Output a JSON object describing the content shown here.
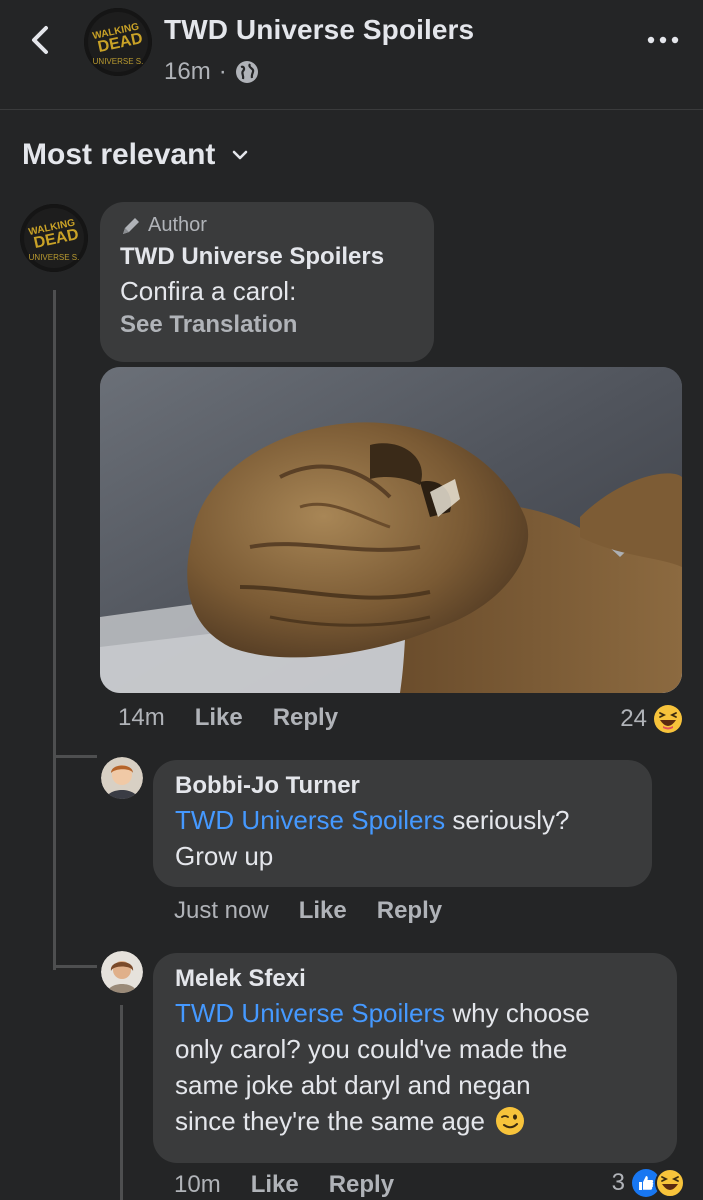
{
  "header": {
    "title": "TWD Universe Spoilers",
    "time": "16m",
    "separator": "·",
    "logo_text": {
      "line1": "WALKING",
      "line2": "DEAD",
      "line3": "UNIVERSE S."
    }
  },
  "sort": {
    "label": "Most relevant"
  },
  "comments": [
    {
      "author_tag": "Author",
      "name": "TWD Universe Spoilers",
      "text": "Confira a carol:",
      "see_translation": "See Translation",
      "time": "14m",
      "like": "Like",
      "reply": "Reply",
      "reaction_count": "24",
      "reactions": [
        "haha"
      ]
    },
    {
      "name": "Bobbi-Jo Turner",
      "mention": "TWD Universe Spoilers",
      "text_line1": " seriously?",
      "text_line2": "Grow up",
      "time": "Just now",
      "like": "Like",
      "reply": "Reply"
    },
    {
      "name": "Melek Sfexi",
      "mention": "TWD Universe Spoilers",
      "text_line1": " why choose",
      "text_line2": "only carol? you could've made the",
      "text_line3": "same joke abt daryl and negan",
      "text_line4": "since they're the same age",
      "emoji": "wink",
      "time": "10m",
      "like": "Like",
      "reply": "Reply",
      "reaction_count": "3",
      "reactions": [
        "like",
        "haha"
      ]
    }
  ],
  "colors": {
    "background": "#242526",
    "bubble": "#3a3b3c",
    "mention": "#4599ff",
    "secondary_text": "#b0b3b8"
  }
}
